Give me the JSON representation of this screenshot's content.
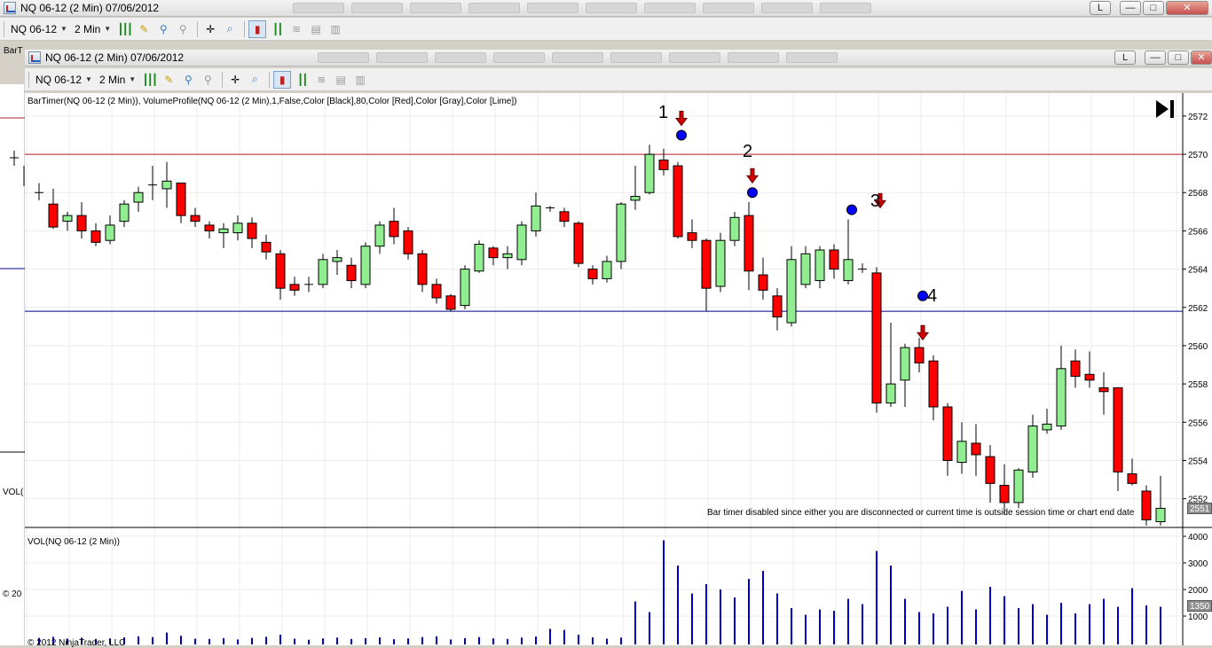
{
  "back_window": {
    "title": "NQ 06-12 (2 Min)  07/06/2012",
    "label_fragment": "BarT",
    "vol_fragment": "VOL(",
    "copyright_fragment": "© 20",
    "button_L": "L",
    "button_min": "—",
    "button_max": "□",
    "button_close": "✕",
    "toolbar": {
      "instrument": "NQ 06-12",
      "interval": "2 Min"
    }
  },
  "front_window": {
    "title": "NQ 06-12 (2 Min)  07/06/2012",
    "button_L": "L",
    "button_min": "—",
    "button_max": "□",
    "button_close": "✕",
    "toolbar": {
      "instrument": "NQ 06-12",
      "interval": "2 Min"
    },
    "indicator_label": "BarTimer(NQ 06-12 (2 Min)), VolumeProfile(NQ 06-12 (2 Min),1,False,Color [Black],80,Color [Red],Color [Gray],Color [Lime])",
    "volume_label": "VOL(NQ 06-12 (2 Min))",
    "bar_timer_message": "Bar timer disabled since either you are disconnected or current time is outside session time or chart end date",
    "copyright": "© 2012 NinjaTrader, LLC",
    "play_end_icon": "skip-to-end-icon"
  },
  "annotations": [
    "1",
    "2",
    "3",
    "4"
  ],
  "price_axis": {
    "ticks": [
      "2572",
      "2570",
      "2568",
      "2566",
      "2564",
      "2562",
      "2560",
      "2558",
      "2556",
      "2554",
      "2552"
    ],
    "current_price": "2551"
  },
  "volume_axis": {
    "ticks": [
      "4000",
      "3000",
      "2000",
      "1000"
    ],
    "current_volume": "1350"
  },
  "colors": {
    "up": "#90ee90",
    "down": "#ff0000",
    "volume": "#0000cd",
    "marker": "#0000ff",
    "resistance": "#b22222",
    "support": "#00008b"
  },
  "chart_data": {
    "type": "candlestick",
    "ylim": [
      2550.5,
      2573.2
    ],
    "resistance_level": 2570,
    "support_level": 2561.8,
    "candles": [
      {
        "o": 2568,
        "h": 2568.5,
        "l": 2567.6,
        "c": 2568
      },
      {
        "o": 2567.4,
        "h": 2568.2,
        "l": 2566.1,
        "c": 2566.2
      },
      {
        "o": 2566.5,
        "h": 2567,
        "l": 2566,
        "c": 2566.8
      },
      {
        "o": 2566.8,
        "h": 2567.5,
        "l": 2565.6,
        "c": 2566
      },
      {
        "o": 2566,
        "h": 2566.4,
        "l": 2565.2,
        "c": 2565.4
      },
      {
        "o": 2565.5,
        "h": 2566.8,
        "l": 2565.3,
        "c": 2566.3
      },
      {
        "o": 2566.5,
        "h": 2567.6,
        "l": 2566.2,
        "c": 2567.4
      },
      {
        "o": 2567.5,
        "h": 2568.3,
        "l": 2567,
        "c": 2568
      },
      {
        "o": 2568.4,
        "h": 2569.4,
        "l": 2567.6,
        "c": 2568.4
      },
      {
        "o": 2568.2,
        "h": 2569.6,
        "l": 2567.2,
        "c": 2568.6
      },
      {
        "o": 2568.5,
        "h": 2568.5,
        "l": 2566.4,
        "c": 2566.8
      },
      {
        "o": 2566.8,
        "h": 2567.2,
        "l": 2566.2,
        "c": 2566.5
      },
      {
        "o": 2566.3,
        "h": 2566.5,
        "l": 2565.6,
        "c": 2566
      },
      {
        "o": 2565.9,
        "h": 2566.4,
        "l": 2565.1,
        "c": 2566.1
      },
      {
        "o": 2565.9,
        "h": 2566.8,
        "l": 2565.5,
        "c": 2566.4
      },
      {
        "o": 2566.4,
        "h": 2566.7,
        "l": 2565.1,
        "c": 2565.6
      },
      {
        "o": 2565.4,
        "h": 2565.8,
        "l": 2564.5,
        "c": 2564.9
      },
      {
        "o": 2564.8,
        "h": 2565,
        "l": 2562.4,
        "c": 2563
      },
      {
        "o": 2563.2,
        "h": 2563.6,
        "l": 2562.6,
        "c": 2562.9
      },
      {
        "o": 2563.2,
        "h": 2563.6,
        "l": 2562.8,
        "c": 2563.2
      },
      {
        "o": 2563.2,
        "h": 2564.8,
        "l": 2563,
        "c": 2564.5
      },
      {
        "o": 2564.4,
        "h": 2565,
        "l": 2563.7,
        "c": 2564.6
      },
      {
        "o": 2564.2,
        "h": 2564.6,
        "l": 2563,
        "c": 2563.4
      },
      {
        "o": 2563.2,
        "h": 2565.4,
        "l": 2563,
        "c": 2565.2
      },
      {
        "o": 2565.2,
        "h": 2566.5,
        "l": 2564.8,
        "c": 2566.3
      },
      {
        "o": 2566.5,
        "h": 2567.2,
        "l": 2565.3,
        "c": 2565.7
      },
      {
        "o": 2566,
        "h": 2566.2,
        "l": 2564.5,
        "c": 2564.8
      },
      {
        "o": 2564.8,
        "h": 2565,
        "l": 2562.8,
        "c": 2563.2
      },
      {
        "o": 2563.2,
        "h": 2563.5,
        "l": 2562.2,
        "c": 2562.5
      },
      {
        "o": 2562.6,
        "h": 2562.7,
        "l": 2561.8,
        "c": 2561.9
      },
      {
        "o": 2562.1,
        "h": 2564.2,
        "l": 2561.9,
        "c": 2564
      },
      {
        "o": 2563.9,
        "h": 2565.5,
        "l": 2563.8,
        "c": 2565.3
      },
      {
        "o": 2565.1,
        "h": 2565.2,
        "l": 2564.2,
        "c": 2564.6
      },
      {
        "o": 2564.6,
        "h": 2565.2,
        "l": 2564,
        "c": 2564.8
      },
      {
        "o": 2564.5,
        "h": 2566.5,
        "l": 2564.2,
        "c": 2566.3
      },
      {
        "o": 2566,
        "h": 2568,
        "l": 2565.7,
        "c": 2567.3
      },
      {
        "o": 2567.2,
        "h": 2567.3,
        "l": 2567,
        "c": 2567.2
      },
      {
        "o": 2567,
        "h": 2567.2,
        "l": 2566.2,
        "c": 2566.5
      },
      {
        "o": 2566.4,
        "h": 2566.5,
        "l": 2564.1,
        "c": 2564.3
      },
      {
        "o": 2564,
        "h": 2564.2,
        "l": 2563.2,
        "c": 2563.5
      },
      {
        "o": 2563.5,
        "h": 2564.7,
        "l": 2563.3,
        "c": 2564.4
      },
      {
        "o": 2564.4,
        "h": 2567.5,
        "l": 2564,
        "c": 2567.4
      },
      {
        "o": 2567.6,
        "h": 2569.4,
        "l": 2567.1,
        "c": 2567.8
      },
      {
        "o": 2568,
        "h": 2570.5,
        "l": 2567.9,
        "c": 2570
      },
      {
        "o": 2569.7,
        "h": 2570.3,
        "l": 2568.9,
        "c": 2569.2
      },
      {
        "o": 2569.4,
        "h": 2569.6,
        "l": 2565.6,
        "c": 2565.7
      },
      {
        "o": 2565.9,
        "h": 2566.6,
        "l": 2565.1,
        "c": 2565.5
      },
      {
        "o": 2565.5,
        "h": 2565.6,
        "l": 2561.8,
        "c": 2563
      },
      {
        "o": 2563.1,
        "h": 2565.9,
        "l": 2562.8,
        "c": 2565.5
      },
      {
        "o": 2565.5,
        "h": 2567,
        "l": 2565.2,
        "c": 2566.7
      },
      {
        "o": 2566.8,
        "h": 2567.5,
        "l": 2562.9,
        "c": 2563.9
      },
      {
        "o": 2563.7,
        "h": 2564.6,
        "l": 2562.4,
        "c": 2562.9
      },
      {
        "o": 2562.6,
        "h": 2563,
        "l": 2560.8,
        "c": 2561.5
      },
      {
        "o": 2561.2,
        "h": 2565.2,
        "l": 2561,
        "c": 2564.5
      },
      {
        "o": 2563.2,
        "h": 2565.2,
        "l": 2563,
        "c": 2564.8
      },
      {
        "o": 2563.4,
        "h": 2565.2,
        "l": 2563,
        "c": 2565
      },
      {
        "o": 2565,
        "h": 2565.3,
        "l": 2563.5,
        "c": 2564
      },
      {
        "o": 2563.4,
        "h": 2566.6,
        "l": 2563.2,
        "c": 2564.5
      },
      {
        "o": 2564,
        "h": 2564.3,
        "l": 2563.8,
        "c": 2564
      },
      {
        "o": 2563.8,
        "h": 2564.1,
        "l": 2556.5,
        "c": 2557
      },
      {
        "o": 2557,
        "h": 2561.2,
        "l": 2556.8,
        "c": 2558
      },
      {
        "o": 2558.2,
        "h": 2560.1,
        "l": 2556.8,
        "c": 2559.9
      },
      {
        "o": 2559.9,
        "h": 2560.4,
        "l": 2558.6,
        "c": 2559.1
      },
      {
        "o": 2559.2,
        "h": 2559.5,
        "l": 2556.1,
        "c": 2556.8
      },
      {
        "o": 2556.8,
        "h": 2557,
        "l": 2553.2,
        "c": 2554
      },
      {
        "o": 2553.9,
        "h": 2556,
        "l": 2553.3,
        "c": 2555
      },
      {
        "o": 2554.9,
        "h": 2555.9,
        "l": 2553.2,
        "c": 2554.3
      },
      {
        "o": 2554.2,
        "h": 2554.8,
        "l": 2551.8,
        "c": 2552.8
      },
      {
        "o": 2552.7,
        "h": 2553.8,
        "l": 2551.2,
        "c": 2551.8
      },
      {
        "o": 2551.8,
        "h": 2553.6,
        "l": 2551.5,
        "c": 2553.5
      },
      {
        "o": 2553.4,
        "h": 2556.4,
        "l": 2553.1,
        "c": 2555.8
      },
      {
        "o": 2555.6,
        "h": 2556.7,
        "l": 2555.4,
        "c": 2555.9
      },
      {
        "o": 2555.8,
        "h": 2560,
        "l": 2555.6,
        "c": 2558.8
      },
      {
        "o": 2559.2,
        "h": 2559.8,
        "l": 2557.8,
        "c": 2558.4
      },
      {
        "o": 2558.5,
        "h": 2559.7,
        "l": 2557.8,
        "c": 2558.2
      },
      {
        "o": 2557.8,
        "h": 2558.6,
        "l": 2556.4,
        "c": 2557.6
      },
      {
        "o": 2557.8,
        "h": 2557.8,
        "l": 2552.4,
        "c": 2553.4
      },
      {
        "o": 2553.3,
        "h": 2554.1,
        "l": 2552.7,
        "c": 2552.8
      },
      {
        "o": 2552.4,
        "h": 2552.7,
        "l": 2550.6,
        "c": 2550.9
      },
      {
        "o": 2550.8,
        "h": 2553.2,
        "l": 2550.6,
        "c": 2551.5
      }
    ],
    "volume_ylim": [
      0,
      4100
    ],
    "volumes": [
      180,
      220,
      150,
      190,
      130,
      160,
      200,
      240,
      210,
      380,
      260,
      150,
      140,
      170,
      120,
      180,
      220,
      300,
      150,
      110,
      160,
      190,
      140,
      170,
      200,
      130,
      160,
      210,
      240,
      120,
      170,
      210,
      160,
      140,
      190,
      230,
      520,
      480,
      300,
      200,
      150,
      190,
      1550,
      1150,
      3850,
      2900,
      1850,
      2200,
      2000,
      1700,
      2400,
      2700,
      1850,
      1300,
      1050,
      1250,
      1200,
      1650,
      1450,
      3450,
      2900,
      1650,
      1150,
      1100,
      1350,
      1950,
      1250,
      2100,
      1750,
      1300,
      1450,
      1050,
      1500,
      1100,
      1450,
      1650,
      1350,
      2050,
      1400,
      1350
    ]
  }
}
